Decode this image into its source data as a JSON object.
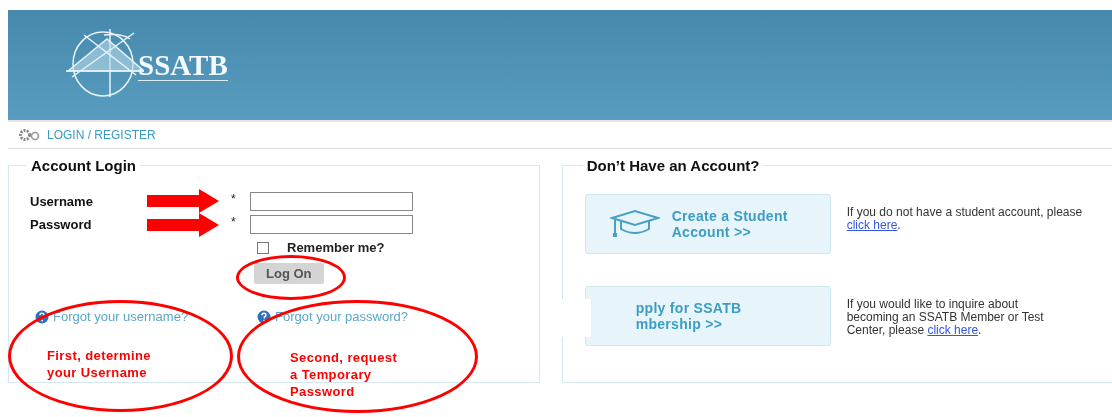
{
  "header": {
    "logo_text": "SSATB"
  },
  "breadcrumb": {
    "label": "LOGIN / REGISTER"
  },
  "login_panel": {
    "title": "Account Login",
    "fields": [
      {
        "label": "Username",
        "required_mark": "*"
      },
      {
        "label": "Password",
        "required_mark": "*"
      }
    ],
    "remember_me": {
      "label": "Remember me?",
      "checked": false
    },
    "submit": "Log On",
    "help_links": [
      "Forgot your username?",
      "Forgot your password?"
    ]
  },
  "signup_panel": {
    "title": "Don’t Have an Account?",
    "options": [
      {
        "kind": "student",
        "lines": [
          "Create a Student",
          "Account >>"
        ],
        "text": "If you do not have a student account, please ",
        "link": "click here",
        "after": "."
      },
      {
        "kind": "membership",
        "lines": [
          "pply for SSATB",
          "mbership >>"
        ],
        "text": "If you would like to inquire about becoming an SSATB Member or Test Center, please ",
        "link": "click here",
        "after": "."
      }
    ]
  },
  "annotations": [
    {
      "kind": "arrow"
    },
    {
      "kind": "arrow"
    },
    {
      "kind": "circle"
    },
    {
      "kind": "note",
      "lines": [
        "First, determine",
        "your Username"
      ]
    },
    {
      "kind": "note",
      "lines": [
        "Second, request",
        "a Temporary",
        "Password"
      ]
    }
  ]
}
